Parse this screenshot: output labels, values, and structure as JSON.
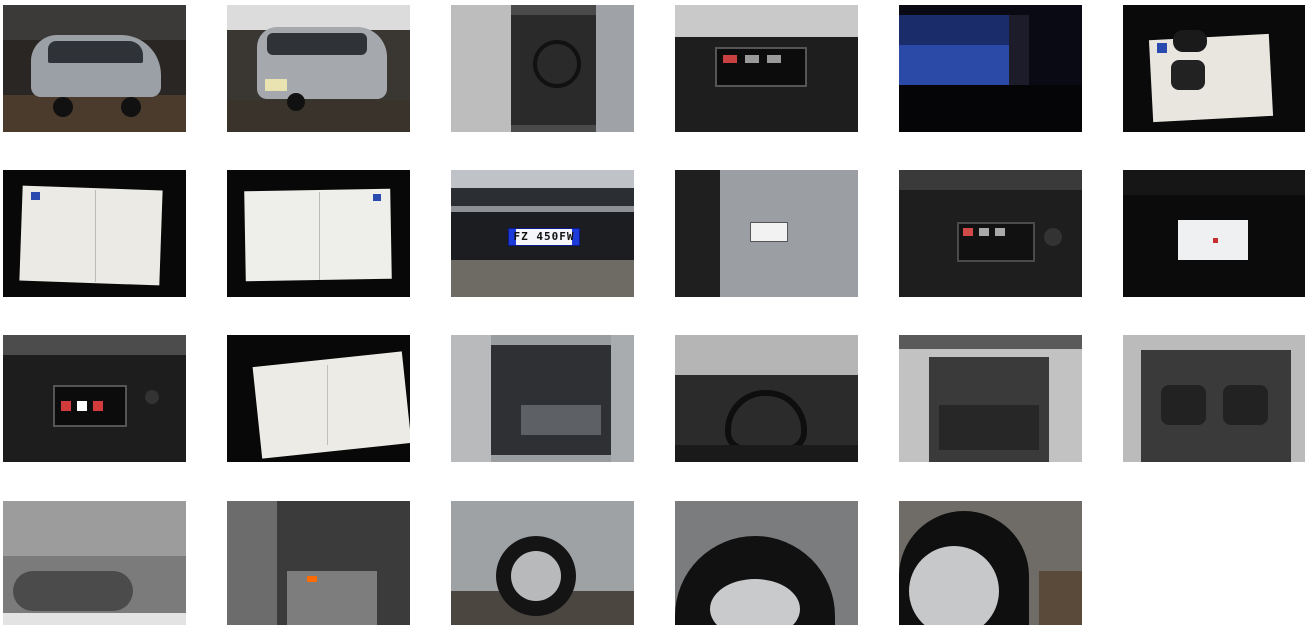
{
  "gallery": {
    "photos": [
      {
        "subject": "car-front-three-quarter"
      },
      {
        "subject": "car-rear-three-quarter"
      },
      {
        "subject": "driver-door-interior"
      },
      {
        "subject": "dashboard-screen"
      },
      {
        "subject": "instrument-display"
      },
      {
        "subject": "keys-and-manual"
      },
      {
        "subject": "document-page-1"
      },
      {
        "subject": "document-page-2"
      },
      {
        "subject": "front-grille-plate",
        "plate_text": "FZ 450FW"
      },
      {
        "subject": "vin-label"
      },
      {
        "subject": "center-console-climate"
      },
      {
        "subject": "navigation-screen"
      },
      {
        "subject": "infotainment-screen"
      },
      {
        "subject": "document-page-3"
      },
      {
        "subject": "rear-seats"
      },
      {
        "subject": "steering-wheel-view"
      },
      {
        "subject": "open-trunk"
      },
      {
        "subject": "trunk-third-row"
      },
      {
        "subject": "underbody"
      },
      {
        "subject": "rear-footwell"
      },
      {
        "subject": "rear-wheel-side"
      },
      {
        "subject": "tire-closeup"
      },
      {
        "subject": "wheel-rim-closeup"
      }
    ]
  }
}
